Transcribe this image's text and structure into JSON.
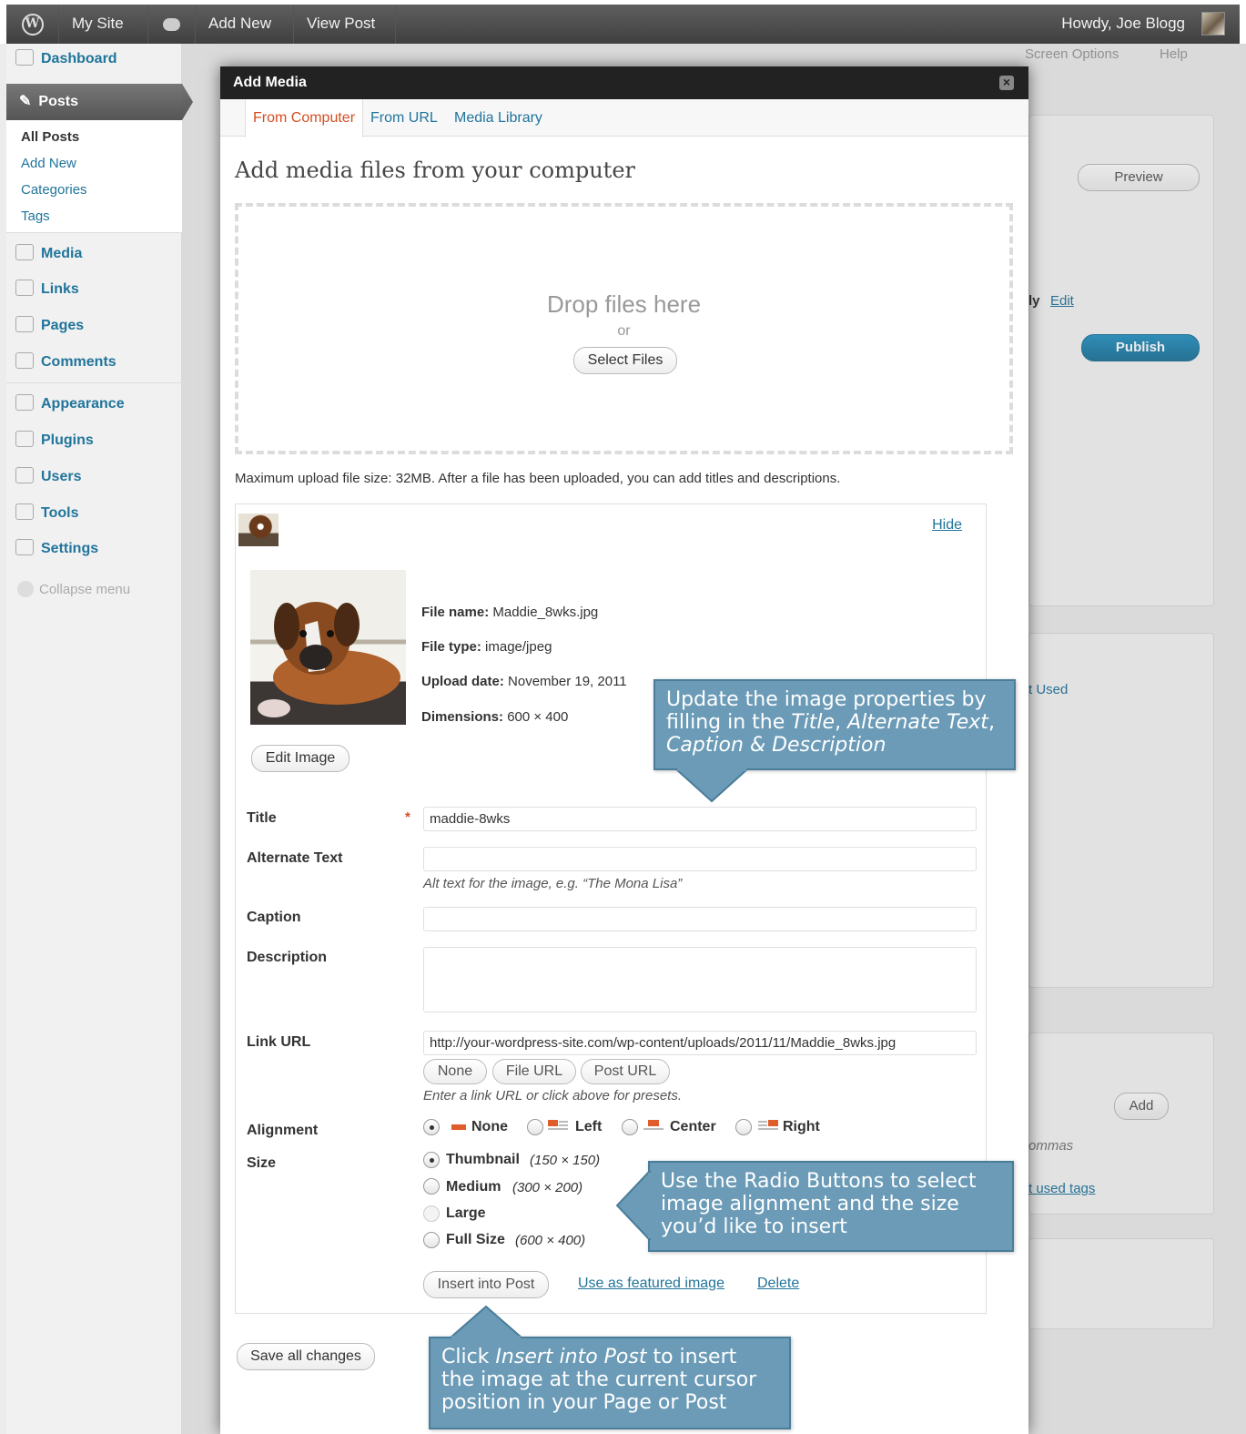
{
  "adminbar": {
    "site_name": "My Site",
    "add_new": "Add New",
    "view_post": "View Post",
    "howdy": "Howdy, Joe Blogg"
  },
  "background": {
    "screen_options": "Screen Options",
    "help": "Help",
    "preview": "Preview",
    "edit_fragment": "ly",
    "edit": "Edit",
    "publish": "Publish",
    "most_used_fragment": "t Used",
    "add": "Add",
    "commas_fragment": "ommas",
    "used_tags_fragment": "t used tags"
  },
  "menu": {
    "dashboard": "Dashboard",
    "posts": "Posts",
    "posts_sub": [
      "All Posts",
      "Add New",
      "Categories",
      "Tags"
    ],
    "media": "Media",
    "links": "Links",
    "pages": "Pages",
    "comments": "Comments",
    "appearance": "Appearance",
    "plugins": "Plugins",
    "users": "Users",
    "tools": "Tools",
    "settings": "Settings",
    "collapse": "Collapse menu"
  },
  "modal": {
    "title": "Add Media",
    "close": "×",
    "tabs": [
      "From Computer",
      "From URL",
      "Media Library"
    ],
    "heading": "Add media files from your computer",
    "drop_text": "Drop files here",
    "drop_or": "or",
    "select_files": "Select Files",
    "max_upload": "Maximum upload file size: 32MB. After a file has been uploaded, you can add titles and descriptions.",
    "hide": "Hide",
    "edit_image": "Edit Image",
    "meta": {
      "file_name_label": "File name:",
      "file_name": "Maddie_8wks.jpg",
      "file_type_label": "File type:",
      "file_type": "image/jpeg",
      "upload_date_label": "Upload date:",
      "upload_date": "November 19, 2011",
      "dimensions_label": "Dimensions:",
      "dimensions": "600 × 400"
    },
    "fields": {
      "title_label": "Title",
      "title_required": "*",
      "title_value": "maddie-8wks",
      "alt_label": "Alternate Text",
      "alt_value": "",
      "alt_help": "Alt text for the image, e.g. “The Mona Lisa”",
      "caption_label": "Caption",
      "caption_value": "",
      "description_label": "Description",
      "description_value": "",
      "link_url_label": "Link URL",
      "link_url_value": "http://your-wordpress-site.com/wp-content/uploads/2011/11/Maddie_8wks.jpg",
      "link_buttons": [
        "None",
        "File URL",
        "Post URL"
      ],
      "link_help": "Enter a link URL or click above for presets.",
      "alignment_label": "Alignment",
      "alignment_options": [
        "None",
        "Left",
        "Center",
        "Right"
      ],
      "alignment_selected": "None",
      "size_label": "Size",
      "size_options": [
        {
          "label": "Thumbnail",
          "dim": "(150 × 150)"
        },
        {
          "label": "Medium",
          "dim": "(300 × 200)"
        },
        {
          "label": "Large",
          "dim": ""
        },
        {
          "label": "Full Size",
          "dim": "(600 × 400)"
        }
      ],
      "size_selected": "Thumbnail"
    },
    "insert_into_post": "Insert into Post",
    "use_featured": "Use as featured image",
    "delete": "Delete",
    "save_all": "Save all changes"
  },
  "callouts": {
    "c1_line1": "Update the image properties by",
    "c1_line2_pre": "filling in the ",
    "c1_title": "Title",
    "c1_comma": ", ",
    "c1_alt": "Alternate Text",
    "c1_comma2": ",",
    "c1_caption": "Caption",
    "c1_amp": " & ",
    "c1_desc": "Description",
    "c2_line1": "Use the Radio Buttons to select",
    "c2_line2": "image alignment and the size",
    "c2_line3": "you’d like to insert",
    "c3_pre": "Click ",
    "c3_insert": "Insert into Post",
    "c3_post": " to insert",
    "c3_line2": "the image at the current cursor",
    "c3_line3": "position in your Page or Post",
    "color": "#6b9bb7"
  }
}
